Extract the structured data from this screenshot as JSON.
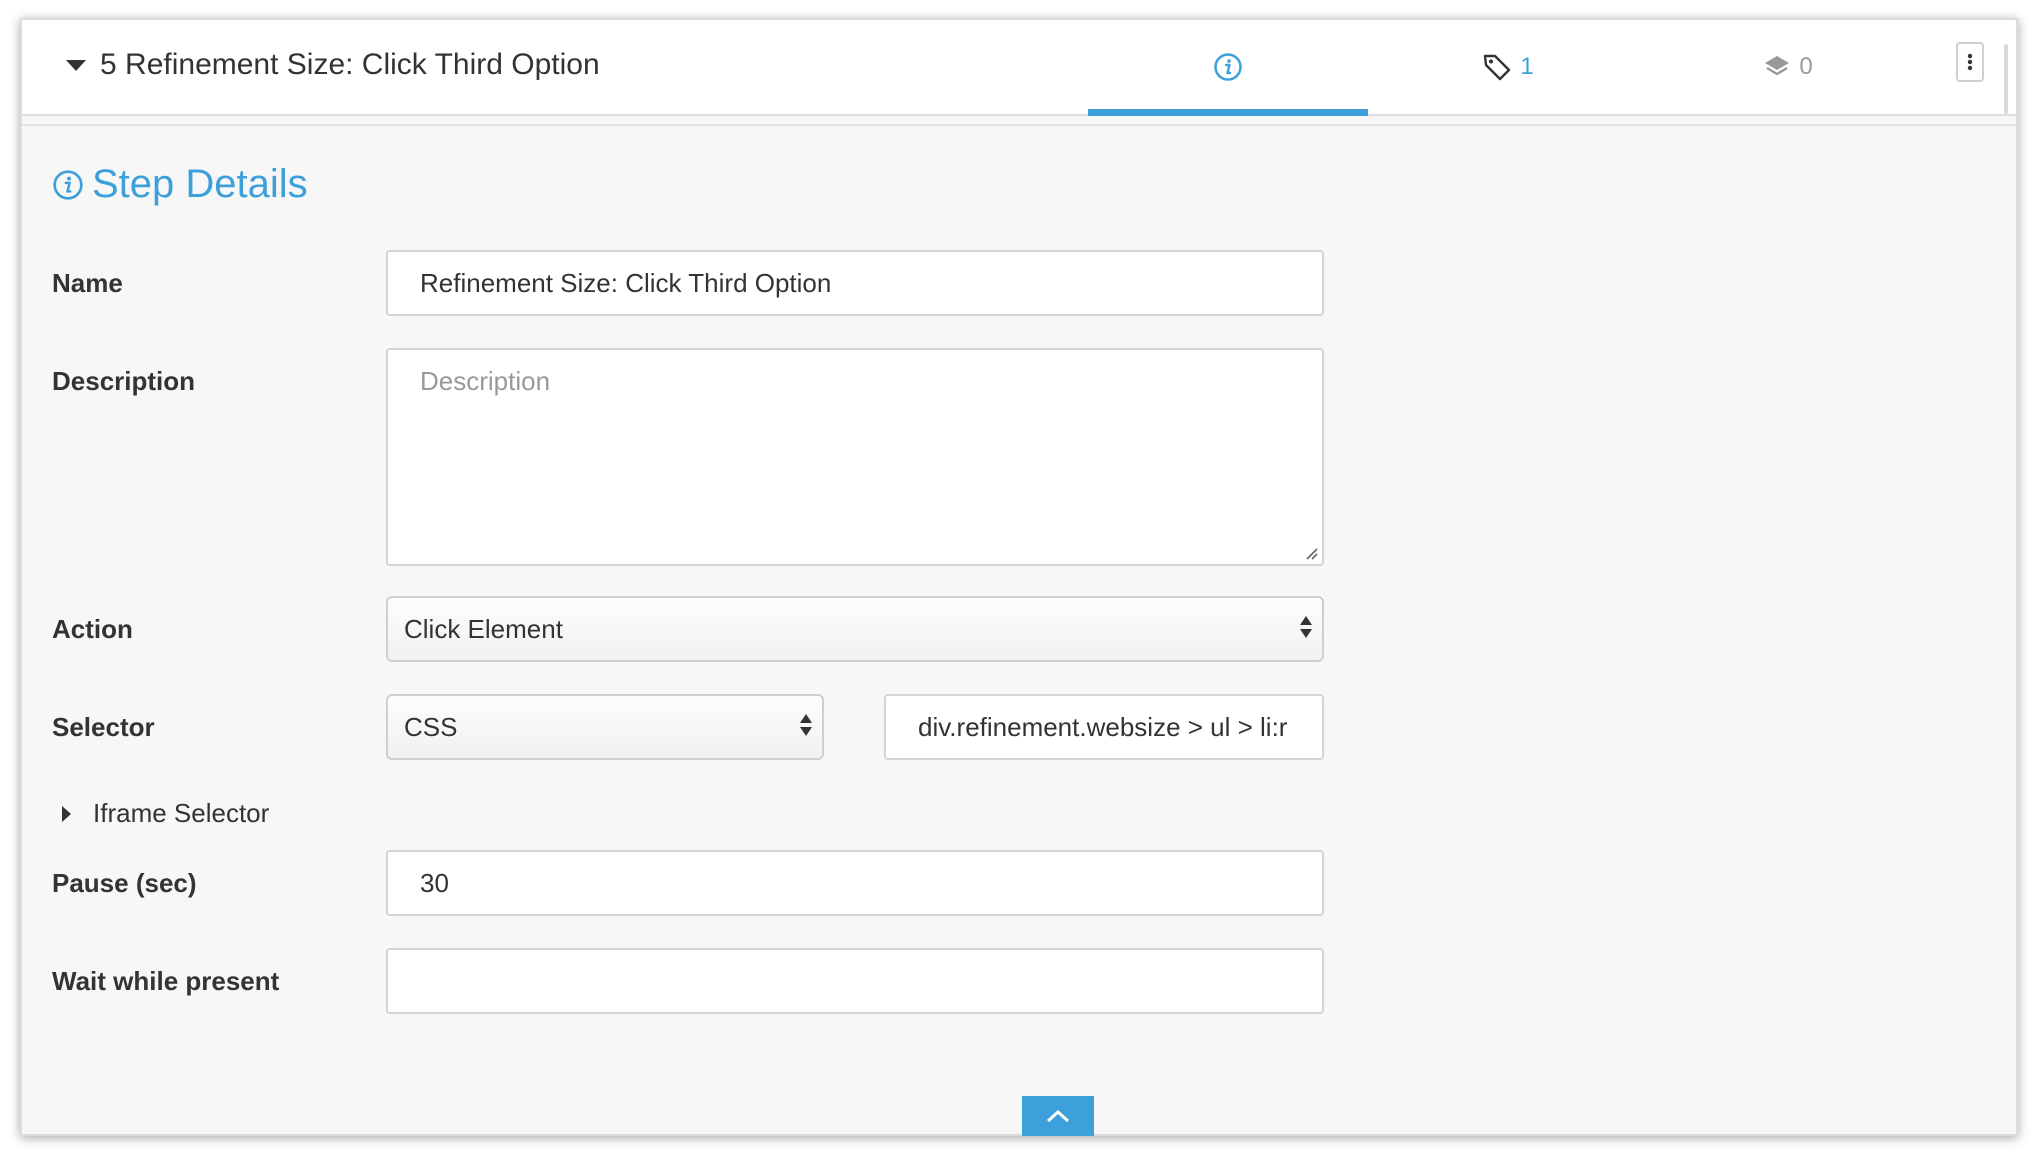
{
  "header": {
    "step_number": "5",
    "step_title": "Refinement Size: Click Third Option",
    "tabs": [
      {
        "name": "info",
        "icon": "info-circle-icon",
        "count": ""
      },
      {
        "name": "tags",
        "icon": "tag-icon",
        "count": "1"
      },
      {
        "name": "layers",
        "icon": "layers-icon",
        "count": "0"
      }
    ]
  },
  "section": {
    "title": "Step Details"
  },
  "form": {
    "name_label": "Name",
    "name_value": "Refinement Size: Click Third Option",
    "description_label": "Description",
    "description_placeholder": "Description",
    "action_label": "Action",
    "action_value": "Click Element",
    "selector_label": "Selector",
    "selector_type": "CSS",
    "selector_value": "div.refinement.websize > ul > li:r",
    "iframe_selector_label": "Iframe Selector",
    "pause_label": "Pause (sec)",
    "pause_value": "30",
    "wait_label": "Wait while present",
    "wait_value": ""
  },
  "colors": {
    "accent": "#3ea0da",
    "panel_bg": "#f7f7f7",
    "text": "#333333"
  }
}
